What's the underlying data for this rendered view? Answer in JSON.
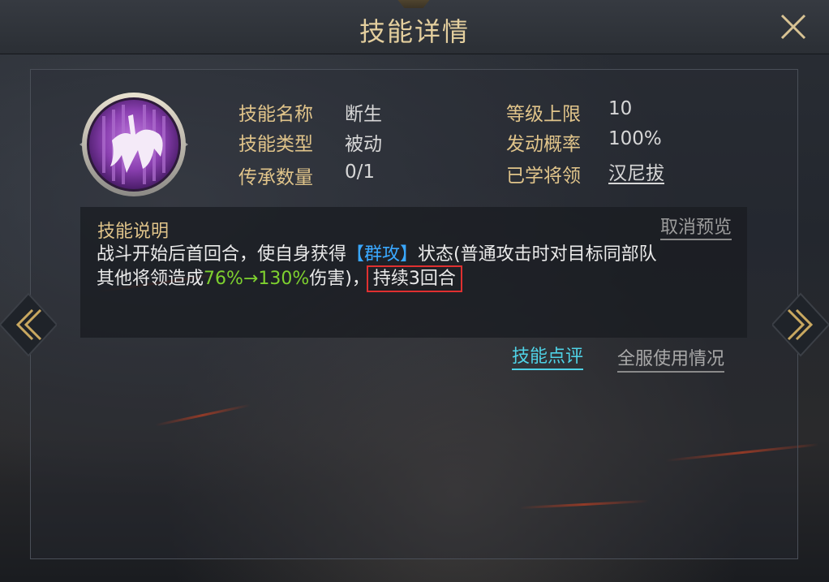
{
  "header": {
    "title": "技能详情"
  },
  "skill": {
    "rows_left": [
      {
        "label": "技能名称",
        "value": "断生"
      },
      {
        "label": "技能类型",
        "value": "被动"
      },
      {
        "label": "传承数量",
        "value": "0/1"
      }
    ],
    "rows_right": [
      {
        "label": "等级上限",
        "value": "10"
      },
      {
        "label": "发动概率",
        "value": "100%"
      },
      {
        "label": "已学将领",
        "value": "汉尼拔"
      }
    ]
  },
  "description": {
    "title": "技能说明",
    "cancel_preview": "取消预览",
    "line1_prefix": "战斗开始后首回合，使自身获得",
    "keyword": "【群攻】",
    "line1_suffix": "状态(普通攻击时对目标同部队",
    "line2_prefix": "其他将领造成",
    "damage_range": "76%→130%",
    "line2_mid": "伤害)，",
    "duration": "持续3回合"
  },
  "actions": {
    "review": "技能点评",
    "server_usage": "全服使用情况"
  },
  "colors": {
    "gold": "#e0c48a",
    "keyword_blue": "#3aa8ff",
    "value_green": "#7ed12f",
    "link_cyan": "#4fd2e6",
    "highlight_red": "#e03030"
  },
  "icons": {
    "skill": "passive-skill-icon",
    "close": "close-icon",
    "prev": "chevron-left-icon",
    "next": "chevron-right-icon"
  }
}
